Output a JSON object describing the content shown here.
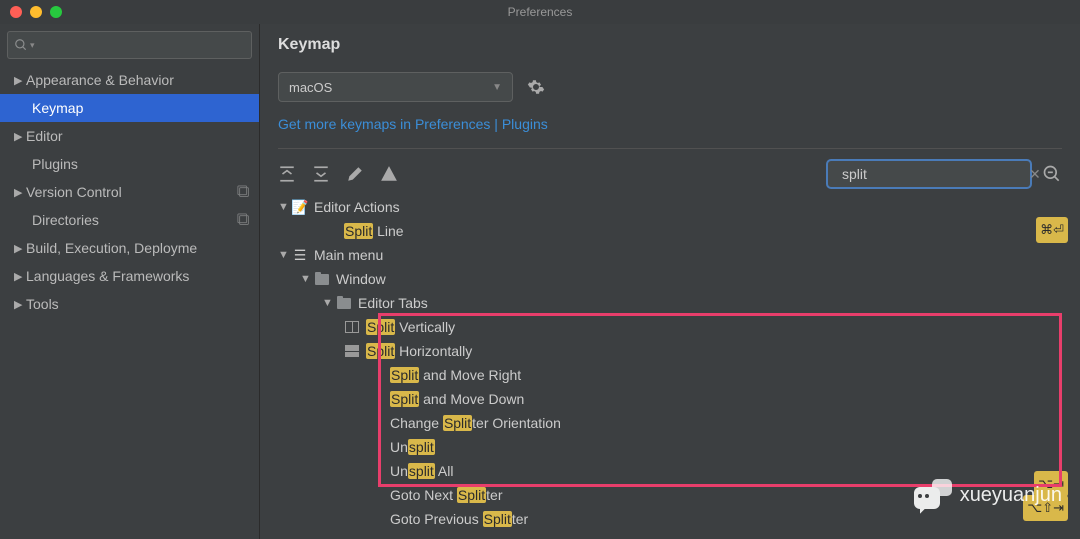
{
  "window": {
    "title": "Preferences"
  },
  "sidebar": {
    "items": [
      {
        "label": "Appearance & Behavior",
        "expandable": true
      },
      {
        "label": "Keymap",
        "expandable": false,
        "selected": true
      },
      {
        "label": "Editor",
        "expandable": true
      },
      {
        "label": "Plugins",
        "expandable": false
      },
      {
        "label": "Version Control",
        "expandable": true,
        "badge": true
      },
      {
        "label": "Directories",
        "expandable": false,
        "badge": true
      },
      {
        "label": "Build, Execution, Deployme",
        "expandable": true
      },
      {
        "label": "Languages & Frameworks",
        "expandable": true
      },
      {
        "label": "Tools",
        "expandable": true
      }
    ]
  },
  "content": {
    "heading": "Keymap",
    "scheme": "macOS",
    "link": "Get more keymaps in Preferences | Plugins",
    "search": "split",
    "tree": {
      "editor_actions": "Editor Actions",
      "split_line": {
        "pre": "Split",
        "post": " Line",
        "shortcut": "⌘⏎"
      },
      "main_menu": "Main menu",
      "window": "Window",
      "editor_tabs": "Editor Tabs",
      "split_v": {
        "pre": "Split",
        "post": " Vertically"
      },
      "split_h": {
        "pre": "Split",
        "post": " Horizontally"
      },
      "split_mr": {
        "pre": "Split",
        "post": " and Move Right"
      },
      "split_md": {
        "pre": "Split",
        "post": " and Move Down"
      },
      "change": {
        "a": "Change ",
        "b": "Split",
        "c": "ter Orientation"
      },
      "unsplit": {
        "a": "Un",
        "b": "split"
      },
      "unsplit_all": {
        "a": "Un",
        "b": "split",
        "c": " All"
      },
      "goto_next": {
        "a": "Goto Next ",
        "b": "Split",
        "c": "ter",
        "shortcut": "⌥⇥"
      },
      "goto_prev": {
        "a": "Goto Previous ",
        "b": "Split",
        "c": "ter",
        "shortcut": "⌥⇧⇥"
      }
    }
  },
  "watermark": "xueyuanjun"
}
